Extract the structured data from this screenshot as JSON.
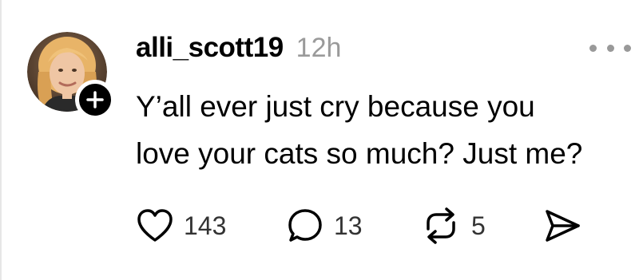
{
  "post": {
    "username": "alli_scott19",
    "timestamp": "12h",
    "text_lines": [
      "Y’all ever just cry because you",
      "love your cats so much? Just me?"
    ],
    "avatar_icon": "avatar-photo",
    "follow_icon": "plus-icon",
    "more_icon": "ellipsis-icon"
  },
  "actions": {
    "like": {
      "icon": "heart-icon",
      "count": "143"
    },
    "reply": {
      "icon": "speech-bubble-icon",
      "count": "13"
    },
    "repost": {
      "icon": "repost-icon",
      "count": "5"
    },
    "share": {
      "icon": "send-icon"
    }
  },
  "colors": {
    "text": "#000000",
    "muted": "#9a9a9a",
    "count": "#333333",
    "badge": "#000000",
    "background": "#ffffff"
  }
}
